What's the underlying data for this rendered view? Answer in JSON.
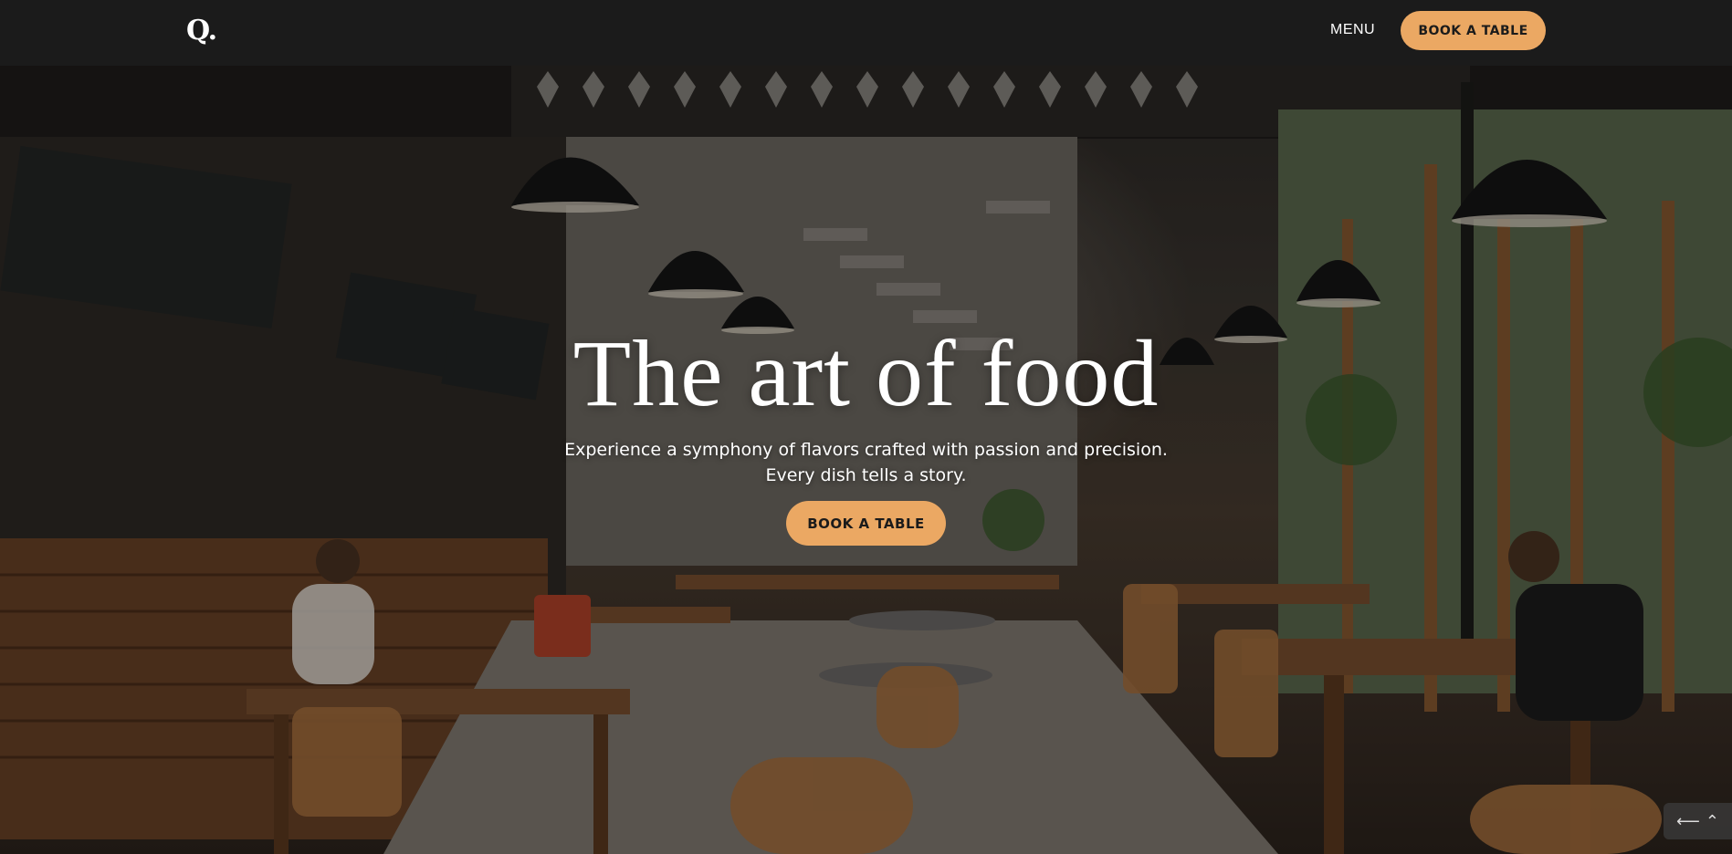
{
  "header": {
    "logo": "Q.",
    "menu_label": "MENU",
    "cta_label": "BOOK A TABLE"
  },
  "hero": {
    "title": "The art of food",
    "subtitle_line1": "Experience a symphony of flavors crafted with passion and precision.",
    "subtitle_line2": "Every dish tells a story.",
    "cta_label": "BOOK A TABLE",
    "background": "cafe-interior-photo"
  },
  "corner_widget": {
    "icons": [
      "arrow-left-icon",
      "arrow-up-icon"
    ],
    "glyph_left": "⟵",
    "glyph_right": "⌃"
  },
  "colors": {
    "accent": "#eba863",
    "header_bg": "#1b1b1b",
    "text": "#ffffff"
  }
}
